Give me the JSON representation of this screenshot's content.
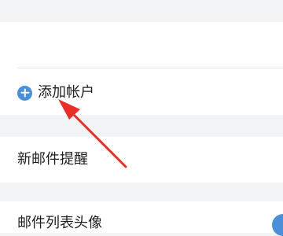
{
  "settings": {
    "add_account_label": "添加帐户",
    "new_mail_alert_label": "新邮件提醒",
    "mail_list_avatar_label": "邮件列表头像"
  },
  "colors": {
    "background": "#f2f3f5",
    "card": "#ffffff",
    "accent_blue": "#4a90d9",
    "annotation_red": "#e8302b"
  },
  "icons": {
    "add": "plus-circle-icon",
    "annotation": "red-arrow-annotation"
  }
}
